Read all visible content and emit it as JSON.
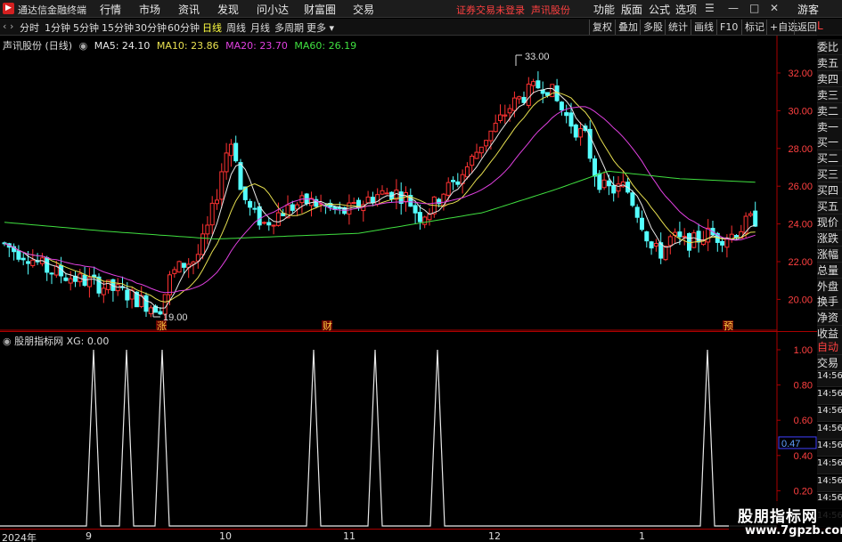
{
  "window": {
    "app_title": "通达信金融终端",
    "menus": [
      "行情",
      "市场",
      "资讯",
      "发现",
      "问小达",
      "财富圈",
      "交易"
    ],
    "login_text": "证券交易未登录",
    "stock_title": "声讯股份",
    "right_menus": [
      "功能",
      "版面",
      "公式",
      "选项"
    ],
    "user": "游客"
  },
  "period_bar": {
    "periods": [
      "分时",
      "1分钟",
      "5分钟",
      "15分钟",
      "30分钟",
      "60分钟",
      "日线",
      "周线",
      "月线",
      "多周期",
      "更多"
    ],
    "active": "日线",
    "tools": [
      "复权",
      "叠加",
      "多股",
      "统计",
      "画线",
      "F10",
      "标记",
      "+自选",
      "返回"
    ]
  },
  "main_chart": {
    "stock_name": "声讯股份 (日线)",
    "ma_legend": [
      {
        "label": "MA5: 24.10",
        "color": "#e8e8e8"
      },
      {
        "label": "MA10: 23.86",
        "color": "#e8e050"
      },
      {
        "label": "MA20: 23.70",
        "color": "#e040e0"
      },
      {
        "label": "MA60: 26.19",
        "color": "#40e040"
      }
    ],
    "price_ticks": [
      "32.00",
      "30.00",
      "28.00",
      "26.00",
      "24.00",
      "22.00",
      "20.00"
    ],
    "high_label": "33.00",
    "low_label": "19.00",
    "markers": [
      "涨",
      "财",
      "预"
    ]
  },
  "side_panel": {
    "red_label": "L",
    "items": [
      "委比",
      "卖五",
      "卖四",
      "卖三",
      "卖二",
      "卖一",
      "买一",
      "买二",
      "买三",
      "买四",
      "买五",
      "现价",
      "涨跌",
      "涨幅",
      "总量",
      "外盘",
      "换手",
      "净资",
      "收益"
    ],
    "auto_trade": [
      "自动",
      "交易"
    ],
    "times": [
      "14:56",
      "14:56",
      "14:56",
      "14:56",
      "14:56",
      "14:56",
      "14:56",
      "14:56",
      "14:56"
    ]
  },
  "sub_chart": {
    "indicator": "股朋指标网 XG: 0.00",
    "ticks": [
      "1.00",
      "0.80",
      "0.60",
      "0.40",
      "0.20"
    ],
    "current_value": "0.47"
  },
  "x_axis": {
    "labels": [
      "2024年",
      "9",
      "10",
      "11",
      "12",
      "1"
    ]
  },
  "watermark": {
    "line1": "股朋指标网",
    "line2": "www.7gpzb.com"
  },
  "colors": {
    "up": "#ff3232",
    "down": "#54ffff",
    "ma5": "#e8e8e8",
    "ma10": "#e8e050",
    "ma20": "#e040e0",
    "ma60": "#40e040"
  }
}
